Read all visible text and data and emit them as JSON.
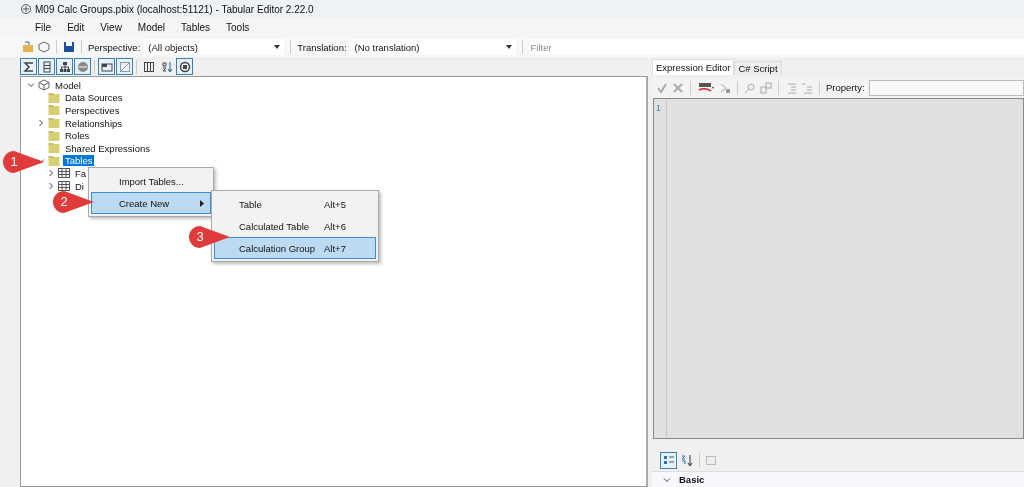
{
  "window": {
    "title": "M09 Calc Groups.pbix (localhost:51121) - Tabular Editor 2.22.0"
  },
  "menu_bar": [
    "File",
    "Edit",
    "View",
    "Model",
    "Tables",
    "Tools"
  ],
  "toolbar": {
    "perspective_label": "Perspective:",
    "perspective_value": "(All objects)",
    "translation_label": "Translation:",
    "translation_value": "(No translation)",
    "filter_placeholder": "Filter"
  },
  "view_buttons": [
    {
      "kind": "sigma",
      "selected": true
    },
    {
      "kind": "column",
      "selected": true
    },
    {
      "kind": "hierarchy",
      "selected": true
    },
    {
      "kind": "partition",
      "selected": true
    },
    {
      "kind": "folder",
      "selected": true
    },
    {
      "kind": "hidden",
      "selected": true
    },
    {
      "kind": "columns",
      "selected": false
    },
    {
      "kind": "sort",
      "selected": false
    },
    {
      "kind": "metadata",
      "selected": true
    }
  ],
  "tree": [
    {
      "label": "Model",
      "kind": "model",
      "expanded": true,
      "selected": false,
      "children": [
        {
          "label": "Data Sources",
          "kind": "folder",
          "selected": false
        },
        {
          "label": "Perspectives",
          "kind": "folder",
          "selected": false
        },
        {
          "label": "Relationships",
          "kind": "folder",
          "expanded": false,
          "selected": false
        },
        {
          "label": "Roles",
          "kind": "folder",
          "selected": false
        },
        {
          "label": "Shared Expressions",
          "kind": "folder",
          "selected": false
        },
        {
          "label": "Tables",
          "kind": "folder",
          "expanded": true,
          "selected": true,
          "children": [
            {
              "label": "Fa",
              "kind": "table",
              "expanded": false,
              "selected": false
            },
            {
              "label": "Di",
              "kind": "table",
              "expanded": false,
              "selected": false
            }
          ]
        }
      ]
    }
  ],
  "context_menu": {
    "items": [
      {
        "label": "Import Tables...",
        "selected": false,
        "submenu": false
      },
      {
        "label": "Create New",
        "selected": true,
        "submenu": true
      }
    ],
    "submenu": [
      {
        "label": "Table",
        "shortcut": "Alt+5",
        "selected": false
      },
      {
        "label": "Calculated Table",
        "shortcut": "Alt+6",
        "selected": false
      },
      {
        "label": "Calculation Group",
        "shortcut": "Alt+7",
        "selected": true
      }
    ]
  },
  "callouts": [
    "1",
    "2",
    "3"
  ],
  "editor": {
    "tabs": [
      {
        "label": "Expression Editor",
        "selected": true
      },
      {
        "label": "C# Script",
        "selected": false
      }
    ],
    "property_label": "Property:",
    "line_numbers": [
      "1"
    ]
  },
  "properties": {
    "section": "Basic",
    "expanded": true
  }
}
